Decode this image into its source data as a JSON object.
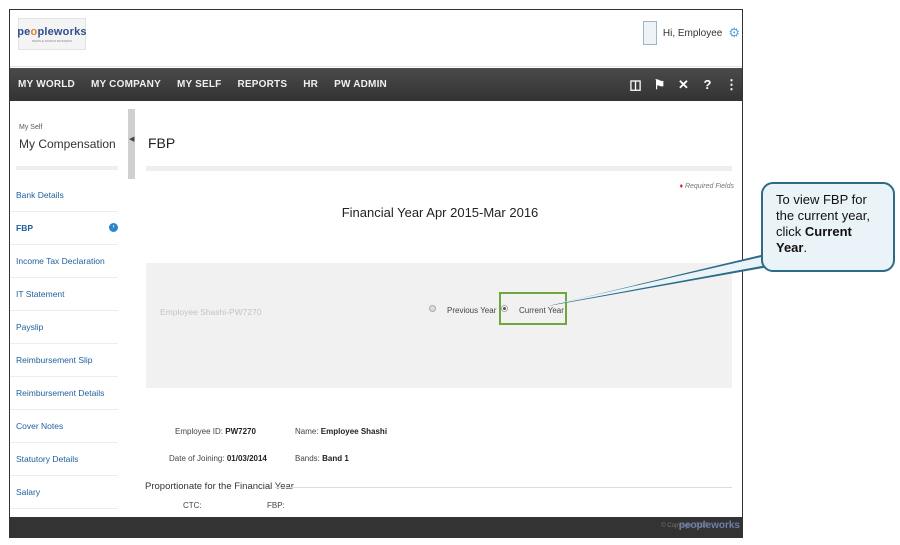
{
  "header": {
    "logo_text_pre": "pe",
    "logo_text_o": "o",
    "logo_text_post": "pleworks",
    "logo_tagline": "PEOPLE WORKS BUSINESS",
    "greeting": "Hi, Employee"
  },
  "nav": {
    "items": [
      "MY WORLD",
      "MY COMPANY",
      "MY SELF",
      "REPORTS",
      "HR",
      "PW ADMIN"
    ],
    "icons": [
      "book-icon",
      "flag-icon",
      "tools-icon",
      "help-icon",
      "share-icon"
    ]
  },
  "sidebar": {
    "crumb_small": "My Self",
    "crumb_title": "My Compensation",
    "items": [
      {
        "label": "Bank Details"
      },
      {
        "label": "FBP"
      },
      {
        "label": "Income Tax Declaration"
      },
      {
        "label": "IT Statement"
      },
      {
        "label": "Payslip"
      },
      {
        "label": "Reimbursement Slip"
      },
      {
        "label": "Reimbursement Details"
      },
      {
        "label": "Cover Notes"
      },
      {
        "label": "Statutory Details"
      },
      {
        "label": "Salary"
      }
    ],
    "active_item": "FBP"
  },
  "main": {
    "title": "FBP",
    "required_fields": "Required Fields",
    "financial_year": "Financial Year Apr 2015-Mar 2016",
    "employee_select": "Employee Shashi-PW7270",
    "previous_year": "Previous Year",
    "current_year": "Current Year",
    "selected_year": "Current Year",
    "employee_id_label": "Employee ID:",
    "employee_id": "PW7270",
    "name_label": "Name:",
    "name": "Employee Shashi",
    "doj_label": "Date of Joining:",
    "doj": "01/03/2014",
    "bands_label": "Bands:",
    "bands": "Band 1",
    "section_title": "Proportionate for the Financial Year",
    "ctc_label": "CTC:",
    "fbp_label": "FBP:"
  },
  "footer": {
    "copyright": "© Copyright 2015",
    "brand": "peopleworks"
  },
  "callout": {
    "line1": "To view FBP for the current year, click ",
    "bold": "Current Year",
    "end": "."
  },
  "colors": {
    "nav_bg": "#3a3a3a",
    "link": "#1e5f9e",
    "highlight": "#6ea83c",
    "callout_border": "#2e6b86",
    "callout_bg": "#eaf3f8"
  }
}
